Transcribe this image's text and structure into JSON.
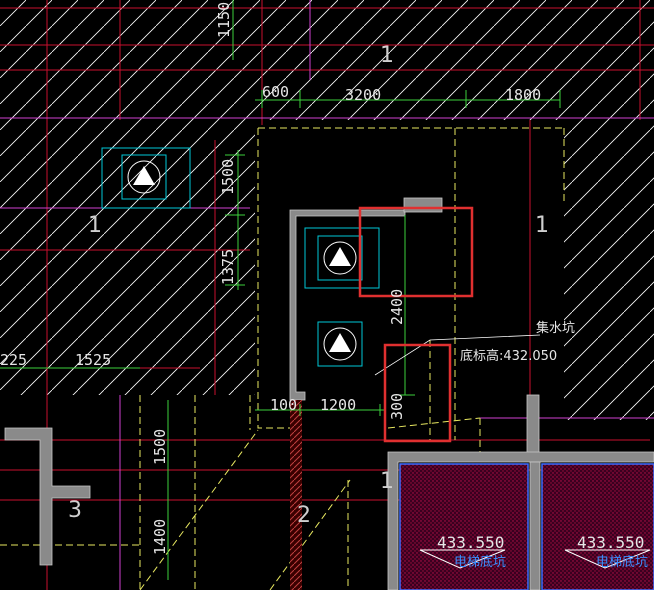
{
  "dimensions": {
    "d1150": "1150",
    "d600": "600",
    "d3200": "3200",
    "d1800": "1800",
    "d1500_top": "1500",
    "d1375": "1375",
    "d2400": "2400",
    "d225": "225",
    "d1525": "1525",
    "d100": "100",
    "d1200": "1200",
    "d300": "300",
    "d1500_left": "1500",
    "d1400": "1400"
  },
  "labels": {
    "n1_top": "1",
    "n1_left": "1",
    "n1_right": "1",
    "n1_mid": "1",
    "n2": "2",
    "n3": "3",
    "sump": "集水坑",
    "bottom_elev": "底标高:432.050",
    "elev_left": "433.550",
    "elev_right": "433.550",
    "pit_left": "电梯底坑",
    "pit_right": "电梯底坑"
  },
  "colors": {
    "background": "#000000",
    "hatch": "#ffffff",
    "wall_fill": "#8a8a8a",
    "grid_red": "#c8102e",
    "grid_magenta": "#d040d0",
    "yellow_dash": "#e8e860",
    "highlight_box": "#e03030",
    "equipment_cyan": "#00c8d8",
    "pit_fill": "#880a40",
    "elev_text": "#3a8fff"
  }
}
